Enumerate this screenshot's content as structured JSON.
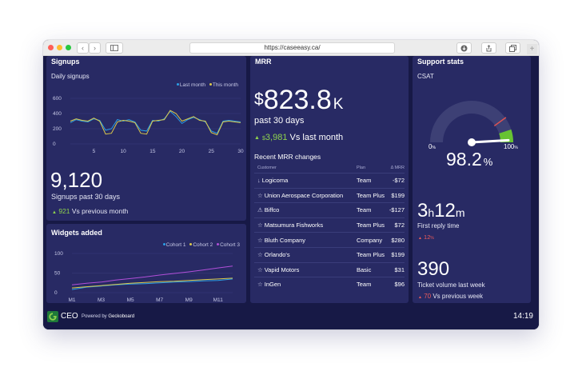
{
  "browser": {
    "url": "https://caseeasy.ca/",
    "back_glyph": "‹",
    "forward_glyph": "›",
    "new_tab_glyph": "+"
  },
  "signups": {
    "title": "Signups",
    "chart_title": "Daily signups",
    "big_value": "9,120",
    "big_label": "Signups past 30 days",
    "change_value": "921",
    "change_text": "Vs previous month",
    "legend": [
      "Last month",
      "This month"
    ],
    "colors": {
      "last_month": "#2b9fe6",
      "this_month": "#dcc94a"
    },
    "chart_data": {
      "type": "line",
      "title": "Daily signups",
      "xlabel": "",
      "ylabel": "",
      "x_ticks": [
        "5",
        "10",
        "15",
        "20",
        "25",
        "30"
      ],
      "y_ticks": [
        "600",
        "400",
        "200",
        "0"
      ],
      "ylim": [
        0,
        600
      ],
      "xlim": [
        1,
        30
      ],
      "x": [
        1,
        2,
        3,
        4,
        5,
        6,
        7,
        8,
        9,
        10,
        11,
        12,
        13,
        14,
        15,
        16,
        17,
        18,
        19,
        20,
        21,
        22,
        23,
        24,
        25,
        26,
        27,
        28,
        29,
        30
      ],
      "series": [
        {
          "name": "Last month",
          "values": [
            280,
            320,
            300,
            290,
            330,
            310,
            180,
            200,
            320,
            300,
            320,
            290,
            180,
            170,
            310,
            300,
            330,
            430,
            360,
            270,
            320,
            350,
            320,
            290,
            170,
            140,
            300,
            310,
            300,
            290
          ]
        },
        {
          "name": "This month",
          "values": [
            300,
            330,
            310,
            300,
            340,
            300,
            130,
            140,
            290,
            310,
            300,
            280,
            140,
            130,
            300,
            310,
            320,
            440,
            400,
            300,
            330,
            360,
            310,
            300,
            150,
            120,
            290,
            300,
            290,
            280
          ]
        }
      ]
    }
  },
  "widgets": {
    "title": "Widgets added",
    "legend": [
      "Cohort 1",
      "Cohort 2",
      "Cohort 3"
    ],
    "colors": {
      "cohort1": "#2b9fe6",
      "cohort2": "#dcc94a",
      "cohort3": "#b14fd8"
    },
    "chart_data": {
      "type": "line",
      "title": "Widgets added",
      "x_ticks": [
        "M1",
        "M3",
        "M5",
        "M7",
        "M9",
        "M11"
      ],
      "y_ticks": [
        "100",
        "50",
        "0"
      ],
      "ylim": [
        0,
        100
      ],
      "x": [
        "M1",
        "M2",
        "M3",
        "M4",
        "M5",
        "M6",
        "M7",
        "M8",
        "M9",
        "M10",
        "M11",
        "M12"
      ],
      "series": [
        {
          "name": "Cohort 1",
          "values": [
            8,
            14,
            17,
            20,
            22,
            23,
            25,
            27,
            28,
            30,
            31,
            35
          ]
        },
        {
          "name": "Cohort 2",
          "values": [
            12,
            15,
            18,
            21,
            24,
            26,
            28,
            29,
            31,
            33,
            35,
            37
          ]
        },
        {
          "name": "Cohort 3",
          "values": [
            20,
            24,
            27,
            32,
            36,
            40,
            45,
            49,
            53,
            58,
            63,
            68
          ]
        }
      ]
    }
  },
  "mrr": {
    "title": "MRR",
    "currency": "$",
    "value": "823.8",
    "suffix": "K",
    "period": "past 30 days",
    "change_currency": "$",
    "change_value": "3,981",
    "change_text": "Vs last month",
    "table_title": "Recent MRR changes",
    "columns": [
      "Customer",
      "Plan",
      "Δ MRR"
    ],
    "rows": [
      {
        "icon": "↓",
        "icon_name": "downgrade-icon",
        "customer": "Logicoma",
        "plan": "Team",
        "amount": "-$72"
      },
      {
        "icon": "☆",
        "icon_name": "new-customer-icon",
        "customer": "Union Aerospace Corporation",
        "plan": "Team Plus",
        "amount": "$199"
      },
      {
        "icon": "⚠",
        "icon_name": "warning-icon",
        "customer": "Biffco",
        "plan": "Team",
        "amount": "-$127"
      },
      {
        "icon": "☆",
        "icon_name": "new-customer-icon",
        "customer": "Matsumura Fishworks",
        "plan": "Team Plus",
        "amount": "$72"
      },
      {
        "icon": "☆",
        "icon_name": "new-customer-icon",
        "customer": "Bluth Company",
        "plan": "Company",
        "amount": "$280"
      },
      {
        "icon": "☆",
        "icon_name": "new-customer-icon",
        "customer": "Orlando's",
        "plan": "Team Plus",
        "amount": "$199"
      },
      {
        "icon": "☆",
        "icon_name": "new-customer-icon",
        "customer": "Vapid Motors",
        "plan": "Basic",
        "amount": "$31"
      },
      {
        "icon": "☆",
        "icon_name": "new-customer-icon",
        "customer": "InGen",
        "plan": "Team",
        "amount": "$96"
      }
    ]
  },
  "support": {
    "title": "Support stats",
    "csat_label": "CSAT",
    "gauge_min": "0",
    "gauge_max": "100",
    "unit": "%",
    "csat_value": "98.2",
    "csat_fraction": 0.982,
    "gauge_green_from": 0.9,
    "gauge_target": 0.8,
    "colors": {
      "gauge_bg": "#3d4075",
      "gauge_green": "#67c332",
      "target": "#e05252",
      "needle": "#ffffff"
    },
    "reply_hours": "3",
    "reply_h": "h",
    "reply_minutes": "12",
    "reply_m": "m",
    "reply_label": "First reply time",
    "reply_change": "12",
    "reply_change_unit": "%",
    "volume": "390",
    "volume_label": "Ticket volume last week",
    "volume_change": "70",
    "volume_change_text": "Vs previous week"
  },
  "footer": {
    "dashboard_name": "CEO",
    "powered_prefix": "Powered by",
    "powered_brand": "Geckoboard",
    "time": "14:19"
  }
}
